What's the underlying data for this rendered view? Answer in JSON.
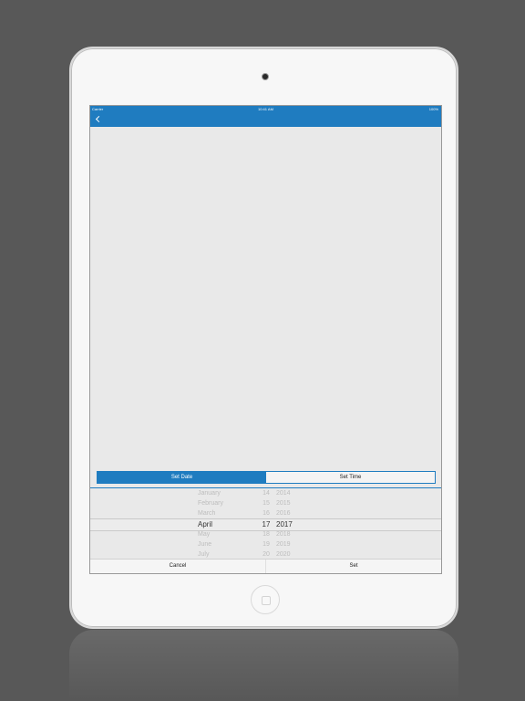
{
  "status_bar": {
    "carrier": "Carrier",
    "time": "10:41 AM",
    "battery": "100%"
  },
  "segments": [
    {
      "label": "Set Date",
      "active": true
    },
    {
      "label": "Set Time",
      "active": false
    }
  ],
  "picker": {
    "months": [
      "January",
      "February",
      "March",
      "April",
      "May",
      "June",
      "July"
    ],
    "days": [
      "14",
      "15",
      "16",
      "17",
      "18",
      "19",
      "20"
    ],
    "years": [
      "2014",
      "2015",
      "2016",
      "2017",
      "2018",
      "2019",
      "2020"
    ],
    "selected_month": "April",
    "selected_day": "17",
    "selected_year": "2017"
  },
  "buttons": {
    "cancel": "Cancel",
    "set": "Set"
  },
  "colors": {
    "accent": "#1f7cc0",
    "background": "#585858"
  }
}
